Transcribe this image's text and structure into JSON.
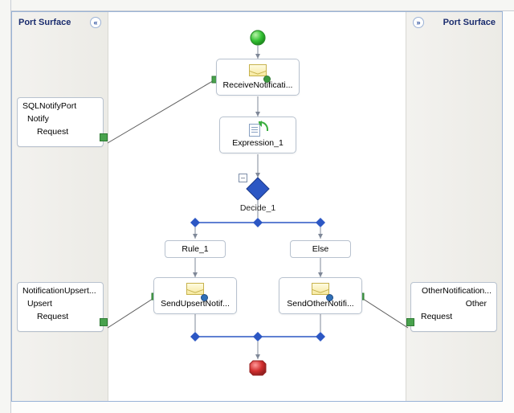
{
  "port_surfaces": {
    "left_label": "Port Surface",
    "right_label": "Port Surface"
  },
  "ports": {
    "sql_notify": {
      "name": "SQLNotifyPort",
      "operation": "Notify",
      "message": "Request"
    },
    "notification_upsert": {
      "name": "NotificationUpsert...",
      "operation": "Upsert",
      "message": "Request"
    },
    "other_notification": {
      "name": "OtherNotification...",
      "operation": "Other",
      "message": "Request"
    }
  },
  "shapes": {
    "receive": "ReceiveNotificati...",
    "expression": "Expression_1",
    "decide": "Decide_1",
    "rule": "Rule_1",
    "else": "Else",
    "send_upsert": "SendUpsertNotif...",
    "send_other": "SendOtherNotifi..."
  },
  "toggle": "–",
  "colors": {
    "diamond": "#2c57c4",
    "start": "#34c234",
    "end": "#d12e2e"
  }
}
